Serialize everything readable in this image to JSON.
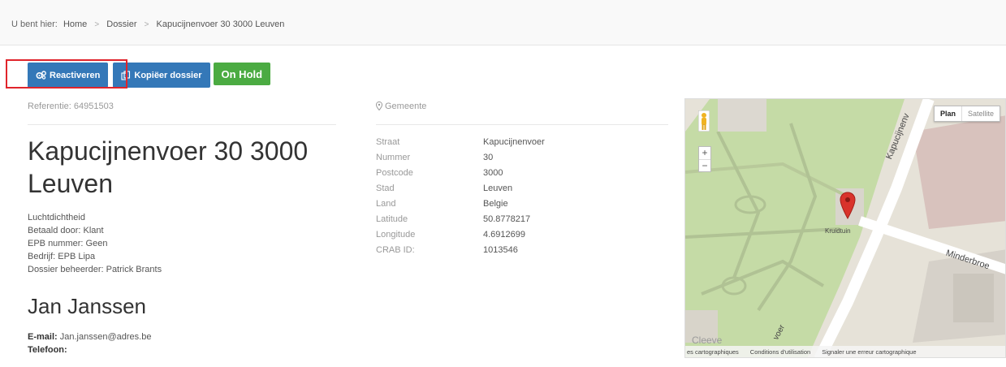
{
  "breadcrumb": {
    "prefix": "U bent hier:",
    "items": [
      "Home",
      "Dossier",
      "Kapucijnenvoer 30 3000 Leuven"
    ],
    "separator": ">"
  },
  "actions": {
    "reactivate_label": "Reactiveren",
    "copy_label": "Kopiëer dossier",
    "status_label": "On Hold"
  },
  "dossier": {
    "reference": "Referentie: 64951503",
    "title": "Kapucijnenvoer 30 3000 Leuven",
    "type": "Luchtdichtheid",
    "paid_by": "Betaald door: Klant",
    "epb_number": "EPB nummer: Geen",
    "company": "Bedrijf: EPB Lipa",
    "manager": "Dossier beheerder: Patrick Brants"
  },
  "contact": {
    "name": "Jan Janssen",
    "email_label": "E-mail:",
    "email": "Jan.janssen@adres.be",
    "phone_label": "Telefoon:"
  },
  "location": {
    "section_label": "Gemeente",
    "properties": [
      {
        "key": "Straat",
        "value": "Kapucijnenvoer"
      },
      {
        "key": "Nummer",
        "value": "30"
      },
      {
        "key": "Postcode",
        "value": "3000"
      },
      {
        "key": "Stad",
        "value": "Leuven"
      },
      {
        "key": "Land",
        "value": "Belgie"
      },
      {
        "key": "Latitude",
        "value": "50.8778217"
      },
      {
        "key": "Longitude",
        "value": "4.6912699"
      },
      {
        "key": "CRAB ID:",
        "value": "1013546"
      }
    ]
  },
  "map": {
    "type_plan": "Plan",
    "type_satellite": "Satellite",
    "zoom_in": "+",
    "zoom_out": "−",
    "street_1": "Kapucijnenv",
    "street_2": "Minderbroe",
    "street_3": "voer",
    "place": "Kruidtuin",
    "faint_label": "Cleeve",
    "footer": [
      "es cartographiques",
      "Conditions d'utilisation",
      "Signaler une erreur cartographique"
    ]
  },
  "colors": {
    "primary_button": "#3478b8",
    "status_green": "#4bab42",
    "highlight": "#e0242b",
    "marker": "#d9332b"
  }
}
